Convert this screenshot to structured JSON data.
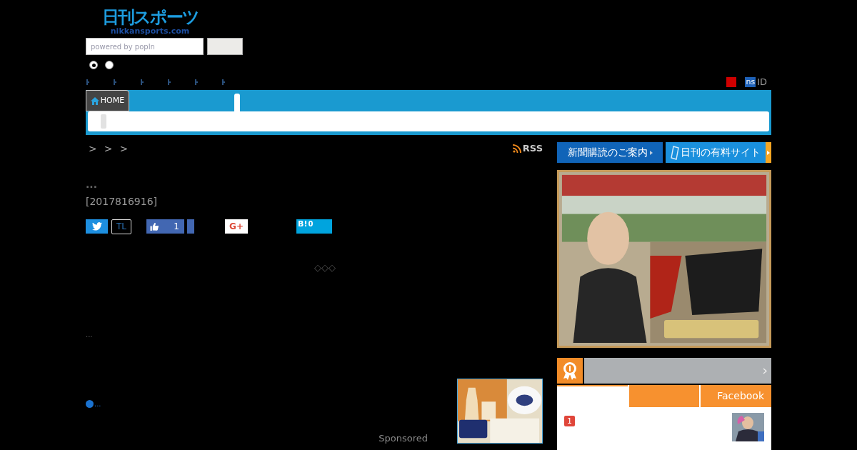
{
  "logo": {
    "title": "日刊スポーツ",
    "domain_parts": [
      "nikkan",
      "sports",
      ".com"
    ]
  },
  "search": {
    "placeholder": "powered by popIn"
  },
  "radios": [
    {
      "selected": true
    },
    {
      "selected": false
    }
  ],
  "account": {
    "badge": "ns",
    "label": "ID"
  },
  "nav": {
    "home": "HOME"
  },
  "breadcrumb": [
    ">",
    ">",
    ">"
  ],
  "rss": "RSS",
  "headline": "...",
  "date": "[2017816916]",
  "share": [
    {
      "kind": "twitter"
    },
    {
      "kind": "timeline",
      "label": "TL"
    },
    {
      "kind": "like",
      "count": "1"
    },
    {
      "kind": "bar"
    },
    {
      "kind": "gplus",
      "label": "G+"
    },
    {
      "kind": "hatena",
      "label": "B!",
      "count": "0"
    }
  ],
  "divider": "◇◇◇",
  "body": "...",
  "related": "...",
  "sponsored": "Sponsored",
  "promo_buttons": [
    {
      "label": "新聞購読のご案内",
      "kind": "subscribe"
    },
    {
      "label": "日刊の有料サイト",
      "kind": "paid"
    }
  ],
  "ranking": {
    "tabs": [
      {
        "selected": true
      },
      {
        "selected": false
      },
      {
        "label": "Facebook",
        "selected": false
      }
    ],
    "items": [
      {
        "rank": "1"
      }
    ]
  }
}
